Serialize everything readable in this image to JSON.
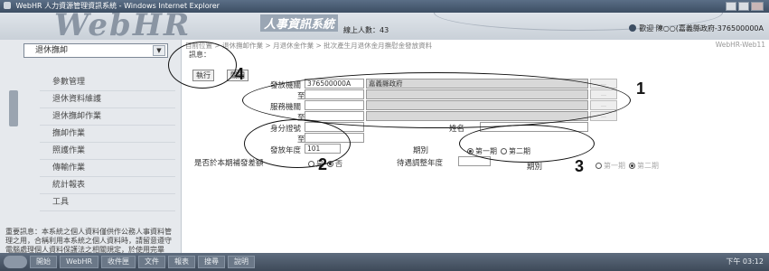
{
  "window": {
    "title": "WebHR 人力資源管理資訊系統 - Windows Internet Explorer"
  },
  "header": {
    "logo": "WebHR",
    "logo_sub": "人事資訊系統",
    "online_users": "線上人數：43",
    "user_info": "歡迎 陳○○(嘉義縣政府-376500000A"
  },
  "sidebar": {
    "system_select": "退休撫卹",
    "menu": [
      "參數管理",
      "退休資料維護",
      "退休撫卹作業",
      "撫卹作業",
      "照護作業",
      "傳輸作業",
      "統計報表",
      "工具"
    ],
    "notice": "重要訊息：本系統之個人資料僅供作公務人事資料管理之用，合稱利用本系統之個人資料時，請留意遵守電腦處理個人資料保護法之相關規定，於使用完畢後，"
  },
  "content": {
    "breadcrumb": "目前位置 > 退休撫卹作業 > 月退休金作業 > 批次產生月退休金月撫慰金發放資料",
    "system_version": "WebHR-Web11",
    "message_label": "訊息：",
    "buttons": {
      "execute": "執行",
      "close": "關閉"
    },
    "form": {
      "paying_agency_label": "發放機關",
      "paying_agency_code": "376500000A",
      "paying_agency_name": "嘉義縣政府",
      "to_label_1": "至",
      "service_agency_label": "服務機關",
      "to_label_2": "至",
      "id_label": "身分證號",
      "to_label_3": "至",
      "name_label": "姓名",
      "year_label": "發放年度",
      "year_value": "101",
      "period_label": "期別",
      "period_options": [
        "第一期",
        "第二期"
      ],
      "period_selected": "第一期",
      "subsidy_label": "是否於本期補發差額",
      "subsidy_options": [
        "是",
        "否"
      ],
      "subsidy_selected": "否",
      "adjust_year_label": "待遇調整年度",
      "adjust_period_label": "期別",
      "adjust_period_options": [
        "第一期",
        "第二期"
      ],
      "adjust_period_selected": "第二期"
    }
  },
  "annotations": [
    "1",
    "2",
    "3",
    "4"
  ],
  "taskbar": {
    "items": [
      "開始",
      "WebHR",
      "收件匣",
      "文件",
      "報表",
      "搜尋",
      "說明"
    ],
    "tray": "下午 03:12"
  },
  "colors": {
    "title_bar": "#3d4e63",
    "sidebar_bg": "#e6e9ed",
    "annotation": "#111111"
  }
}
